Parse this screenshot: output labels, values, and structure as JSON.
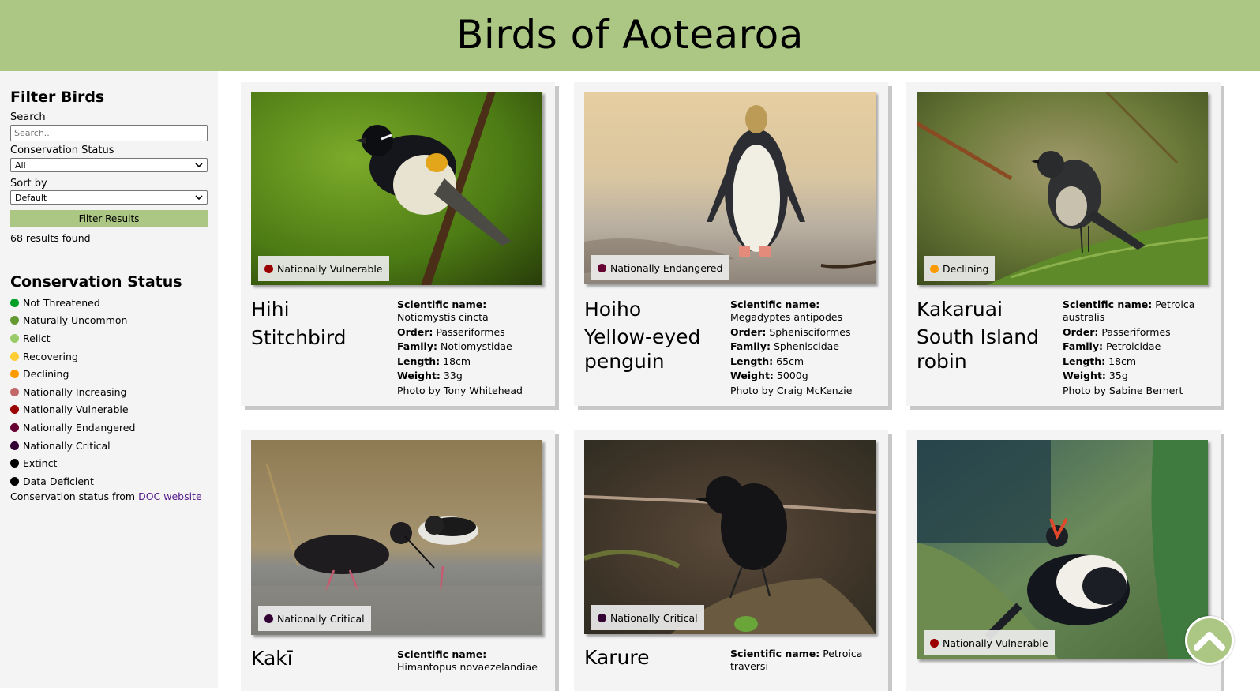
{
  "header": {
    "title": "Birds of Aotearoa"
  },
  "sidebar": {
    "filter_title": "Filter Birds",
    "search_label": "Search",
    "search_placeholder": "Search..",
    "search_value": "",
    "status_label": "Conservation Status",
    "status_selected": "All",
    "sort_label": "Sort by",
    "sort_selected": "Default",
    "filter_button": "Filter Results",
    "results_text": "68 results found",
    "legend_title": "Conservation Status",
    "legend": [
      {
        "label": "Not Threatened",
        "color": "#02a028"
      },
      {
        "label": "Naturally Uncommon",
        "color": "#649a31"
      },
      {
        "label": "Relict",
        "color": "#99cb68"
      },
      {
        "label": "Recovering",
        "color": "#fecc33"
      },
      {
        "label": "Declining",
        "color": "#fe9a01"
      },
      {
        "label": "Nationally Increasing",
        "color": "#c26967"
      },
      {
        "label": "Nationally Vulnerable",
        "color": "#9b0000"
      },
      {
        "label": "Nationally Endangered",
        "color": "#660032"
      },
      {
        "label": "Nationally Critical",
        "color": "#320033"
      },
      {
        "label": "Extinct",
        "color": "#000000"
      },
      {
        "label": "Data Deficient",
        "color": "#000000"
      }
    ],
    "source_prefix": "Conservation status from ",
    "source_link": "DOC website"
  },
  "cards": [
    {
      "maori_name": "Hihi",
      "english_name": "Stitchbird",
      "status": "Nationally Vulnerable",
      "status_color": "#9b0000",
      "scientific_label": "Scientific name:",
      "scientific": "Notiomystis cincta",
      "order_label": "Order:",
      "order": "Passeriformes",
      "family_label": "Family:",
      "family": "Notiomystidae",
      "length_label": "Length:",
      "length": "18cm",
      "weight_label": "Weight:",
      "weight": "33g",
      "photo_credit": "Photo by Tony Whitehead"
    },
    {
      "maori_name": "Hoiho",
      "english_name": "Yellow-eyed penguin",
      "status": "Nationally Endangered",
      "status_color": "#660032",
      "scientific_label": "Scientific name:",
      "scientific": "Megadyptes antipodes",
      "order_label": "Order:",
      "order": "Sphenisciformes",
      "family_label": "Family:",
      "family": "Spheniscidae",
      "length_label": "Length:",
      "length": "65cm",
      "weight_label": "Weight:",
      "weight": "5000g",
      "photo_credit": "Photo by Craig McKenzie"
    },
    {
      "maori_name": "Kakaruai",
      "english_name": "South Island robin",
      "status": "Declining",
      "status_color": "#fe9a01",
      "scientific_label": "Scientific name:",
      "scientific": "Petroica australis",
      "order_label": "Order:",
      "order": "Passeriformes",
      "family_label": "Family:",
      "family": "Petroicidae",
      "length_label": "Length:",
      "length": "18cm",
      "weight_label": "Weight:",
      "weight": "35g",
      "photo_credit": "Photo by Sabine Bernert"
    },
    {
      "maori_name": "Kakī",
      "english_name": "",
      "status": "Nationally Critical",
      "status_color": "#320033",
      "scientific_label": "Scientific name:",
      "scientific": "Himantopus novaezelandiae"
    },
    {
      "maori_name": "Karure",
      "english_name": "",
      "status": "Nationally Critical",
      "status_color": "#320033",
      "scientific_label": "Scientific name:",
      "scientific": "Petroica traversi"
    },
    {
      "maori_name": "",
      "english_name": "",
      "status": "Nationally Vulnerable",
      "status_color": "#9b0000"
    }
  ],
  "icons": {
    "dropdown": "chevron-down-icon",
    "scroll_top": "chevron-up-icon"
  }
}
